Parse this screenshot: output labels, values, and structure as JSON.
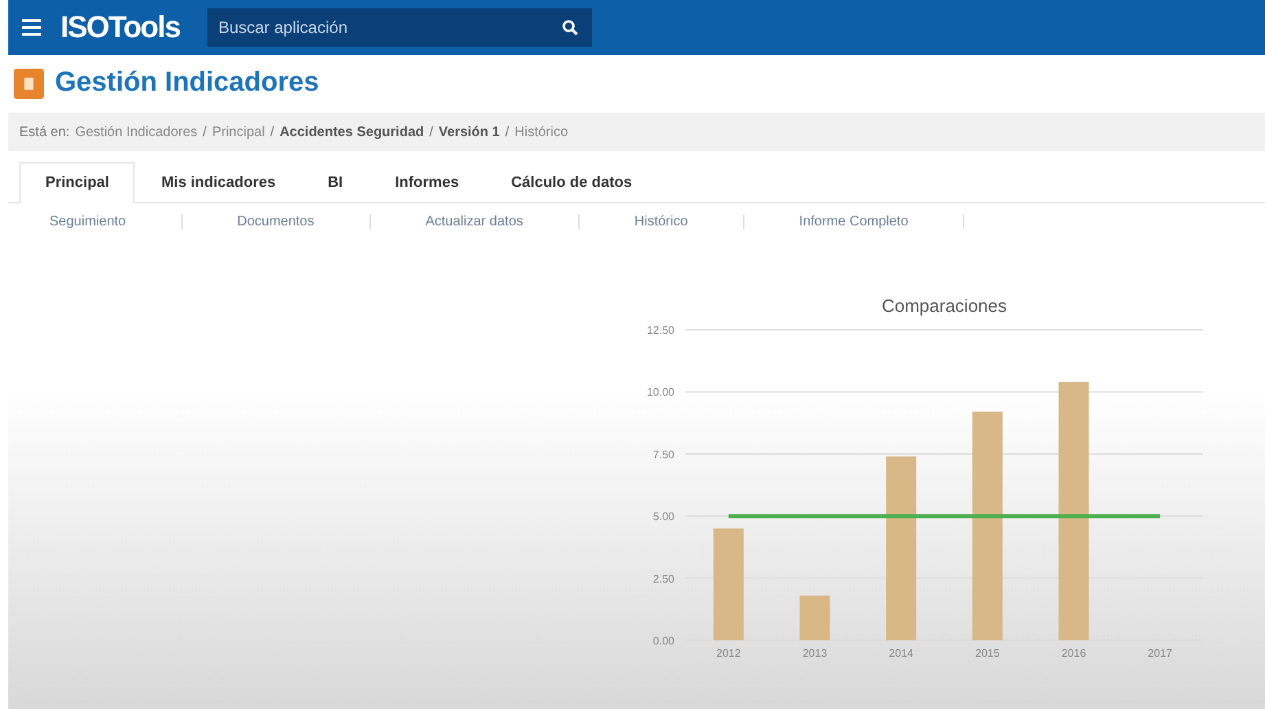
{
  "header": {
    "logo": "ISOTools",
    "search": {
      "placeholder": "Buscar aplicación"
    }
  },
  "page_title": "Gestión Indicadores",
  "breadcrumb": {
    "prefix": "Está en:",
    "separator": "/",
    "items": [
      {
        "label": "Gestión Indicadores",
        "current": false
      },
      {
        "label": "Principal",
        "current": false
      },
      {
        "label": "Accidentes Seguridad",
        "current": true
      },
      {
        "label": "Versión 1",
        "current": true
      },
      {
        "label": "Histórico",
        "current": false
      }
    ]
  },
  "tabs": [
    {
      "label": "Principal",
      "selected": true
    },
    {
      "label": "Mis indicadores",
      "selected": false
    },
    {
      "label": "BI",
      "selected": false
    },
    {
      "label": "Informes",
      "selected": false
    },
    {
      "label": "Cálculo de datos",
      "selected": false
    }
  ],
  "subtabs": [
    "Seguimiento",
    "Documentos",
    "Actualizar datos",
    "Histórico",
    "Informe Completo"
  ],
  "chart": {
    "chart_data": {
      "type": "bar",
      "title": "Comparaciones",
      "categories": [
        "2012",
        "2013",
        "2014",
        "2015",
        "2016",
        "2017"
      ],
      "series": [
        {
          "color": "#d8b887",
          "values": [
            4.5,
            1.8,
            7.4,
            9.2,
            10.4,
            null
          ]
        },
        {
          "type": "line",
          "color": "#4caf50",
          "values": [
            5,
            5,
            5,
            5,
            5,
            5
          ]
        }
      ],
      "ylim": [
        0,
        12.5
      ],
      "grid": true,
      "yticks": [
        {
          "value": 0,
          "label": "0.00"
        },
        {
          "value": 2.5,
          "label": "2.50"
        },
        {
          "value": 5,
          "label": "5.00"
        },
        {
          "value": 7.5,
          "label": "7.50"
        },
        {
          "value": 10,
          "label": "10.00"
        },
        {
          "value": 12.5,
          "label": "12.50"
        }
      ]
    }
  }
}
